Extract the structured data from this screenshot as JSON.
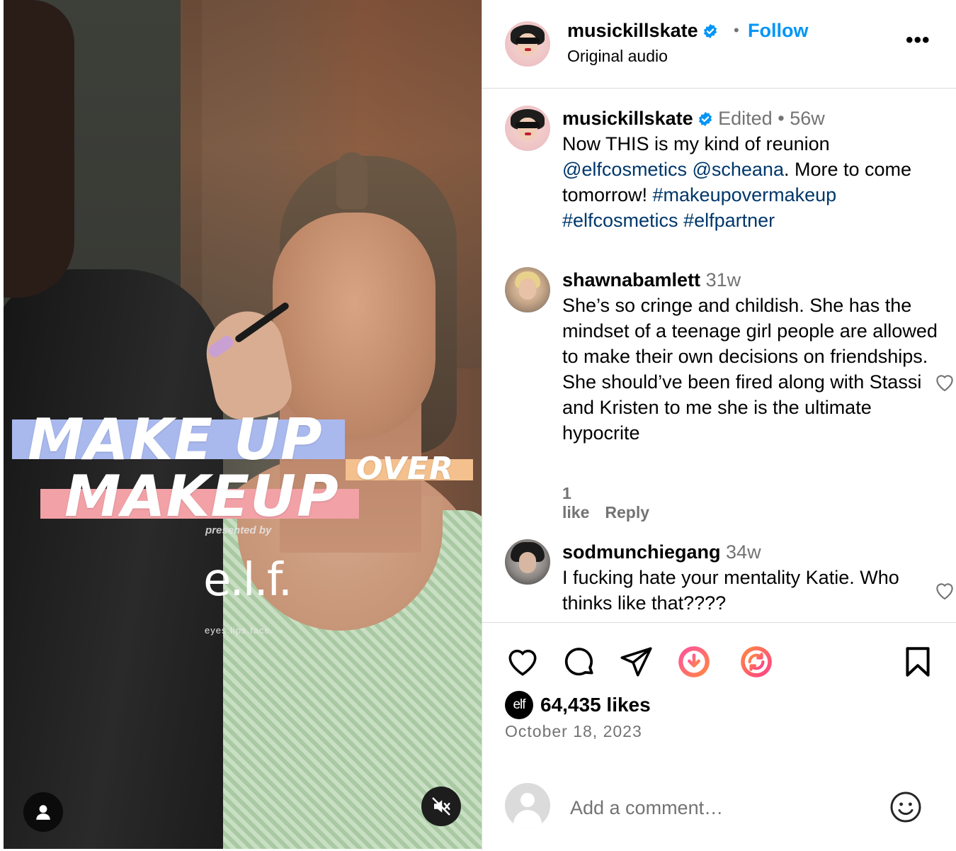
{
  "video": {
    "title_line1": "MAKE UP",
    "title_line2": "MAKEUP",
    "title_over": "OVER",
    "presented_by": "presented by",
    "brand_logo": "e.l.f.",
    "brand_tagline": "eyes.lips.face.",
    "icons": {
      "user": "user-icon",
      "mute": "muted-speaker-icon"
    }
  },
  "header": {
    "username": "musickillskate",
    "verified": true,
    "dot": "•",
    "follow_label": "Follow",
    "audio": "Original audio",
    "more_label": "•••"
  },
  "caption": {
    "username": "musickillskate",
    "edited": "Edited",
    "dot": "•",
    "age": "56w",
    "text_1": "Now THIS is my kind of reunion ",
    "mention_1": "@elfcosmetics",
    "space": " ",
    "mention_2": "@scheana",
    "text_2": ". More to come tomorrow! ",
    "tag_1": "#makeupovermakeup",
    "tag_2": "#elfcosmetics",
    "tag_3": "#elfpartner"
  },
  "comments": [
    {
      "username": "shawnabamlett",
      "age": "31w",
      "text": "She’s so cringe and childish. She has the mindset of a teenage girl people are allowed to make their own decisions on friendships. She should’ve been fired along with Stassi and Kristen to me she is the ultimate hypocrite",
      "likes": "1 like",
      "reply": "Reply"
    },
    {
      "username": "sodmunchiegang",
      "age": "34w",
      "text": "I fucking hate your mentality Katie. Who thinks like that????"
    }
  ],
  "actions": {
    "icons": [
      "heart-icon",
      "comment-icon",
      "share-icon",
      "download-icon",
      "repost-icon",
      "bookmark-icon"
    ],
    "likes": "64,435 likes",
    "liker_avatar": "elf",
    "date": "October 18, 2023"
  },
  "compose": {
    "placeholder": "Add a comment…"
  },
  "colors": {
    "link": "#00376b",
    "follow": "#0095f6",
    "muted_text": "#737373",
    "verified": "#0095f6",
    "title_band_blue": "#a9b9ee",
    "title_band_pink": "#f2a1a6",
    "title_band_orange": "#f3c08e"
  }
}
